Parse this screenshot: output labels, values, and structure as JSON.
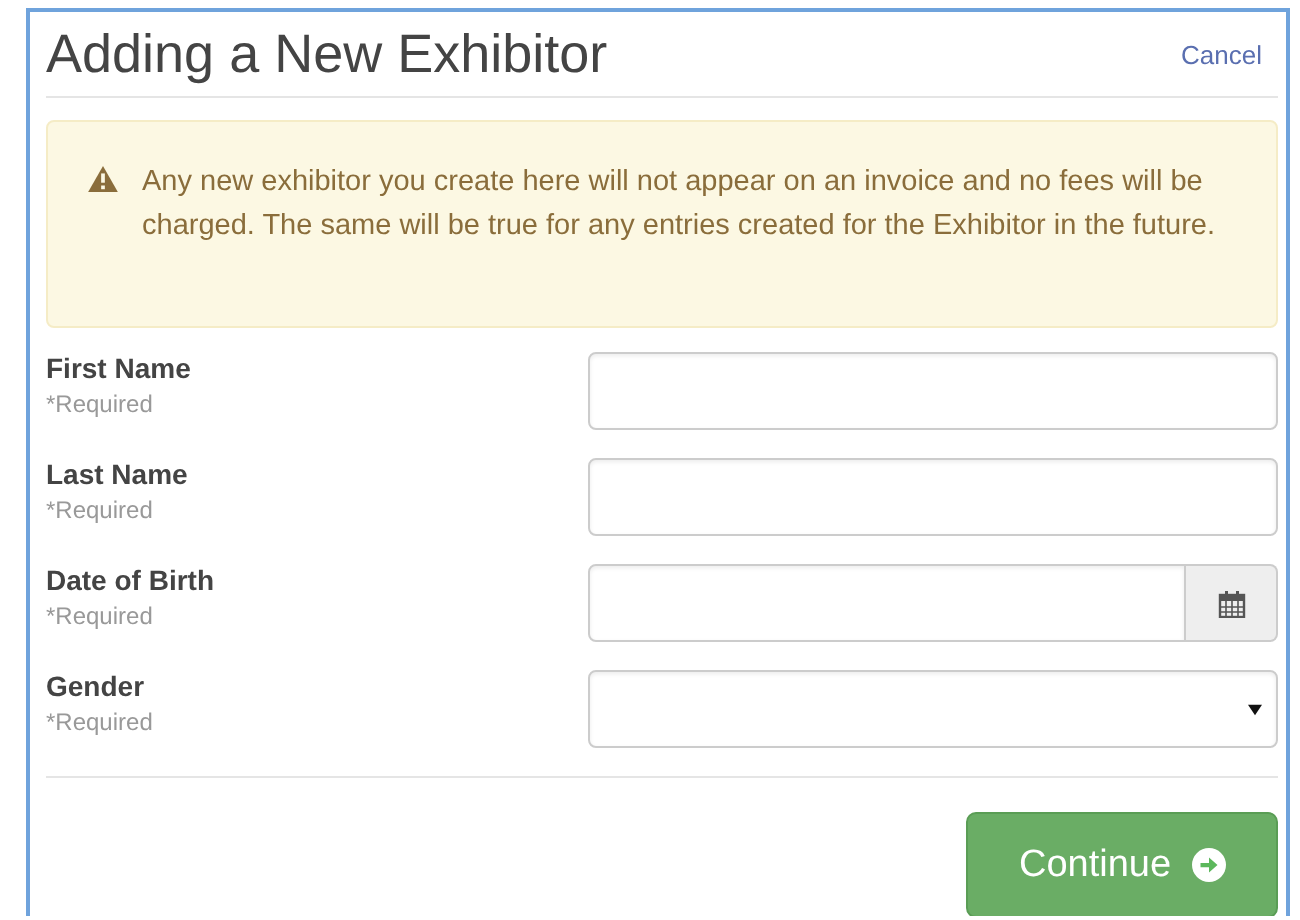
{
  "dialog": {
    "title": "Adding a New Exhibitor",
    "cancel": "Cancel"
  },
  "alert": {
    "text": "Any new exhibitor you create here will not appear on an invoice and no fees will be charged. The same will be true for any entries created for the Exhibitor in the future."
  },
  "fields": [
    {
      "label": "First Name",
      "note": "*Required",
      "kind": "text"
    },
    {
      "label": "Last Name",
      "note": "*Required",
      "kind": "text"
    },
    {
      "label": "Date of Birth",
      "note": "*Required",
      "kind": "date"
    },
    {
      "label": "Gender",
      "note": "*Required",
      "kind": "select"
    }
  ],
  "continue_button": {
    "label": "Continue"
  }
}
